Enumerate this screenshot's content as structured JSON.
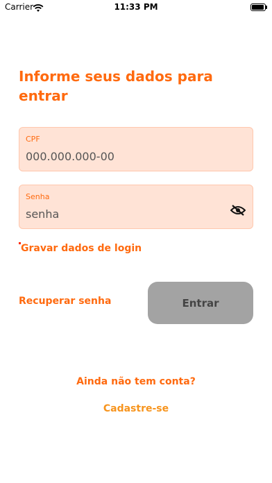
{
  "status_bar": {
    "carrier": "Carrier",
    "time": "11:33 PM"
  },
  "login": {
    "heading": "Informe seus dados para entrar",
    "cpf": {
      "label": "CPF",
      "placeholder": "000.000.000-00"
    },
    "password": {
      "label": "Senha",
      "placeholder": "senha",
      "toggle_icon": "eye-off-icon"
    },
    "remember_label": "Gravar dados de login",
    "recover_label": "Recuperar senha",
    "submit_label": "Entrar",
    "no_account_label": "Ainda não tem conta?",
    "signup_label": "Cadastre-se"
  },
  "colors": {
    "accent": "#ff6a0f",
    "signup": "#f7941d",
    "field_bg": "#ffe3d6",
    "button_disabled": "#a3a3a3"
  }
}
